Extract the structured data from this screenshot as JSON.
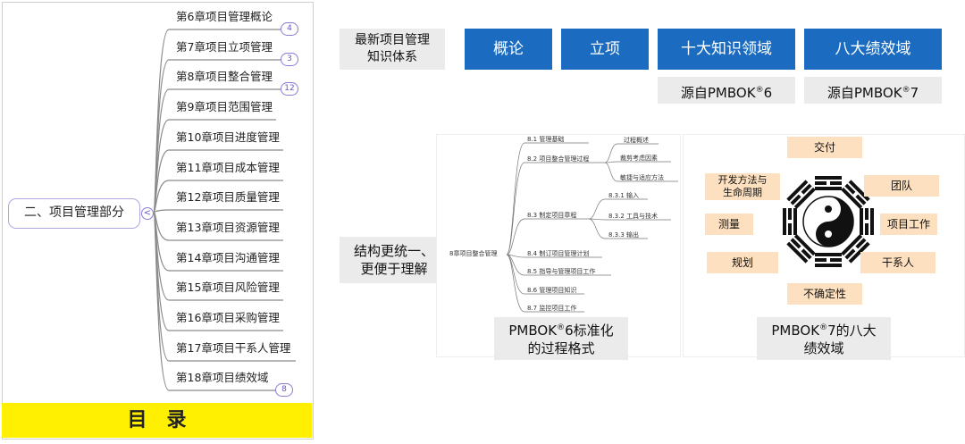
{
  "mindmap": {
    "root": "二、项目管理部分",
    "collapse_glyph": "<",
    "chapters": [
      {
        "label": "第6章项目管理概论",
        "badge": "4"
      },
      {
        "label": "第7章项目立项管理",
        "badge": "3"
      },
      {
        "label": "第8章项目整合管理",
        "badge": "12"
      },
      {
        "label": "第9章项目范围管理"
      },
      {
        "label": "第10章项目进度管理"
      },
      {
        "label": "第11章项目成本管理"
      },
      {
        "label": "第12章项目质量管理"
      },
      {
        "label": "第13章项目资源管理"
      },
      {
        "label": "第14章项目沟通管理"
      },
      {
        "label": "第15章项目风险管理"
      },
      {
        "label": "第16章项目采购管理"
      },
      {
        "label": "第17章项目干系人管理"
      },
      {
        "label": "第18章项目绩效域",
        "badge": "8"
      }
    ],
    "toc_label": "目录",
    "line_color": "#8a8a8a",
    "accent_color": "#8e7ad3"
  },
  "top_row": {
    "system_label_line1": "最新项目管理",
    "system_label_line2": "知识体系",
    "tags": [
      "概论",
      "立项",
      "十大知识领域",
      "八大绩效域"
    ],
    "source_prefix": "源自PMBOK",
    "source_6": "6",
    "source_7": "7",
    "reg": "®",
    "blue": "#1b6cc0"
  },
  "unify_label_line1": "结构更统一、",
  "unify_label_line2": "更便于理解",
  "pmbok6_tree": {
    "root": "8章项目整合管理",
    "items": [
      "8.1  管理基础",
      "8.2  项目整合管理过程",
      "8.3  制定项目章程",
      "8.4  制订项目管理计划",
      "8.5  指导与管理项目工作",
      "8.6  管理项目知识",
      "8.7  监控项目工作"
    ],
    "sub_82": [
      "过程概述",
      "裁剪考虑因素",
      "敏捷与适应方法"
    ],
    "sub_83": [
      "8.3.1  输入",
      "8.3.2  工具与技术",
      "8.3.3  输出"
    ],
    "caption_line1_prefix": "PMBOK",
    "caption_line1_suffix": "6标准化",
    "caption_line2": "的过程格式"
  },
  "pmbok7": {
    "domains": {
      "top": "交付",
      "upper_left_line1": "开发方法与",
      "upper_left_line2": "生命周期",
      "upper_right": "团队",
      "left": "测量",
      "right": "项目工作",
      "lower_left": "规划",
      "lower_right": "干系人",
      "bottom": "不确定性"
    },
    "caption_line1_prefix": "PMBOK",
    "caption_line1_suffix": "7的八大",
    "caption_line2": "绩效域",
    "domain_color": "#fde0bf"
  }
}
